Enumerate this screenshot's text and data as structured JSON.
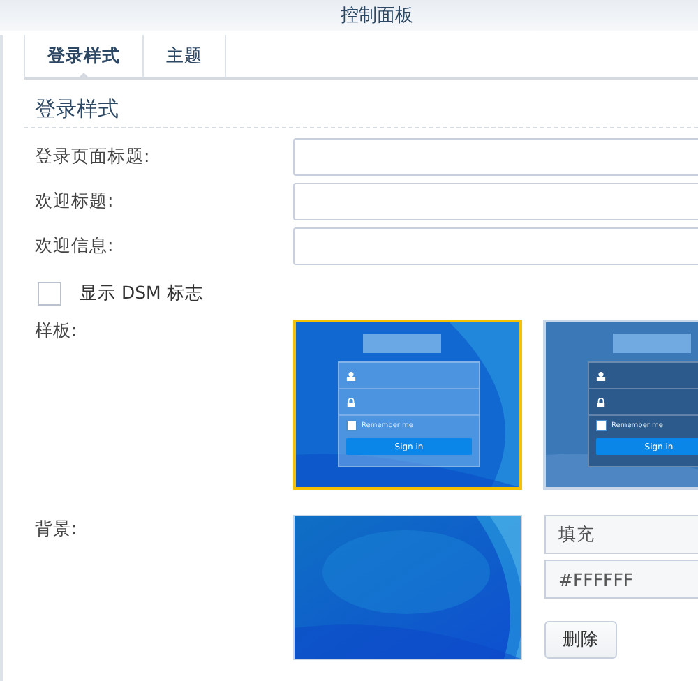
{
  "window": {
    "title": "控制面板"
  },
  "tabs": [
    {
      "label": "登录样式",
      "selected": true
    },
    {
      "label": "主题",
      "selected": false
    }
  ],
  "section": {
    "title": "登录样式"
  },
  "fields": [
    {
      "label": "登录页面标题:"
    },
    {
      "label": "欢迎标题:"
    },
    {
      "label": "欢迎信息:"
    }
  ],
  "show_logo": {
    "label": "显示 DSM 标志",
    "checked": false
  },
  "templates": {
    "label": "样板:",
    "items": [
      {
        "selected": true,
        "remember_label": "Remember me",
        "signin_label": "Sign in"
      },
      {
        "selected": false,
        "remember_label": "Remember me",
        "signin_label": "Sign in"
      }
    ]
  },
  "background": {
    "label": "背景:",
    "mode": "填充",
    "color_value": "#FFFFFF",
    "delete_button": "删除"
  }
}
